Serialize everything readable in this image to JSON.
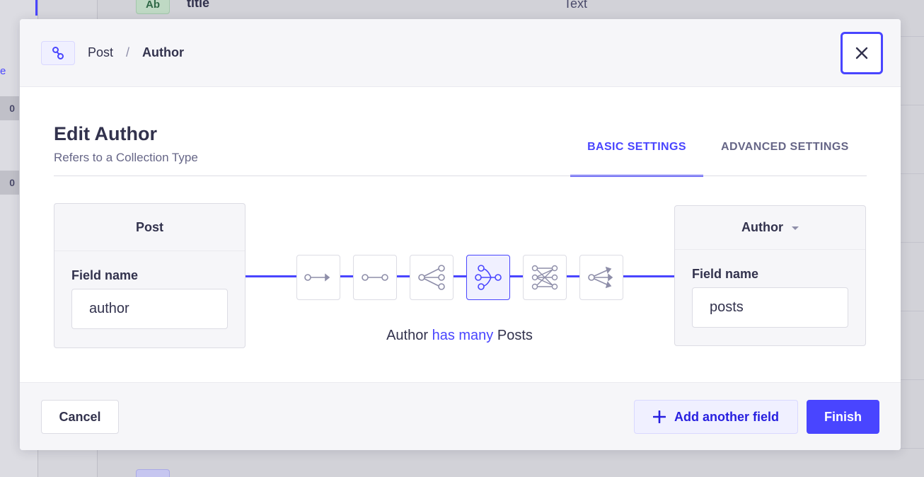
{
  "background": {
    "counts": [
      "0",
      "0"
    ],
    "edge_letter": "e",
    "row": {
      "badge": "Ab",
      "name": "title",
      "type": "Text"
    }
  },
  "modal": {
    "breadcrumb": {
      "parent": "Post",
      "separator": "/",
      "current": "Author"
    },
    "title": "Edit Author",
    "subtitle": "Refers to a Collection Type",
    "tabs": [
      {
        "label": "BASIC SETTINGS",
        "active": true
      },
      {
        "label": "ADVANCED SETTINGS",
        "active": false
      }
    ],
    "left_box": {
      "title": "Post",
      "field_label": "Field name",
      "field_value": "author"
    },
    "right_box": {
      "title": "Author",
      "field_label": "Field name",
      "field_value": "posts"
    },
    "relations": [
      {
        "icon": "one-way-icon",
        "active": false
      },
      {
        "icon": "one-to-one-icon",
        "active": false
      },
      {
        "icon": "one-to-many-icon",
        "active": false
      },
      {
        "icon": "many-to-one-icon",
        "active": true
      },
      {
        "icon": "many-to-many-icon",
        "active": false
      },
      {
        "icon": "many-way-icon",
        "active": false
      }
    ],
    "sentence": {
      "start": "Author",
      "relation": "has many",
      "end": "Posts"
    },
    "footer": {
      "cancel": "Cancel",
      "add_field": "Add another field",
      "finish": "Finish"
    },
    "colors": {
      "accent": "#4945ff",
      "neutral_text": "#32324d",
      "muted_text": "#666687"
    }
  }
}
